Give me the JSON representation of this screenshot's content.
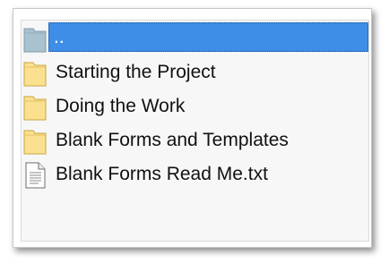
{
  "colors": {
    "selection": "#3e8ee8",
    "folder_fill": "#fbe08f",
    "folder_edge": "#c9a640",
    "parent_folder_fill": "#a9c2cf",
    "parent_folder_edge": "#7f9bab"
  },
  "list": {
    "items": [
      {
        "label": "..",
        "icon": "parent-folder-icon",
        "selected": true
      },
      {
        "label": "Starting the Project",
        "icon": "folder-icon"
      },
      {
        "label": "Doing the Work",
        "icon": "folder-icon"
      },
      {
        "label": "Blank Forms and Templates",
        "icon": "folder-icon"
      },
      {
        "label": "Blank Forms Read Me.txt",
        "icon": "text-file-icon"
      }
    ]
  }
}
